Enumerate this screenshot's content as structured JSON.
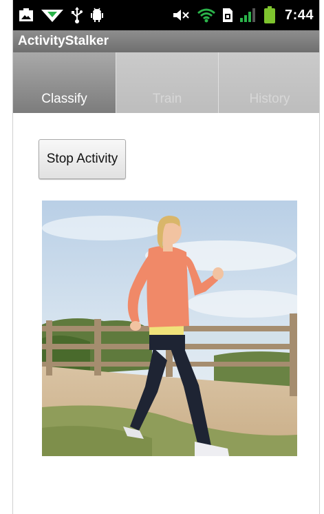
{
  "status_bar": {
    "time": "7:44",
    "left_icons": [
      "photo-notification-icon",
      "wifi-download-icon",
      "usb-icon",
      "android-debug-icon"
    ],
    "right_icons": [
      "mute-icon",
      "wifi-icon",
      "sim-icon",
      "signal-icon",
      "battery-icon"
    ],
    "battery_color": "#7ec42e"
  },
  "app": {
    "title": "ActivityStalker"
  },
  "tabs": [
    {
      "label": "Classify",
      "selected": true
    },
    {
      "label": "Train",
      "selected": false
    },
    {
      "label": "History",
      "selected": false
    }
  ],
  "main": {
    "action_button_label": "Stop Activity",
    "image_subject": "woman-walking-photo"
  }
}
